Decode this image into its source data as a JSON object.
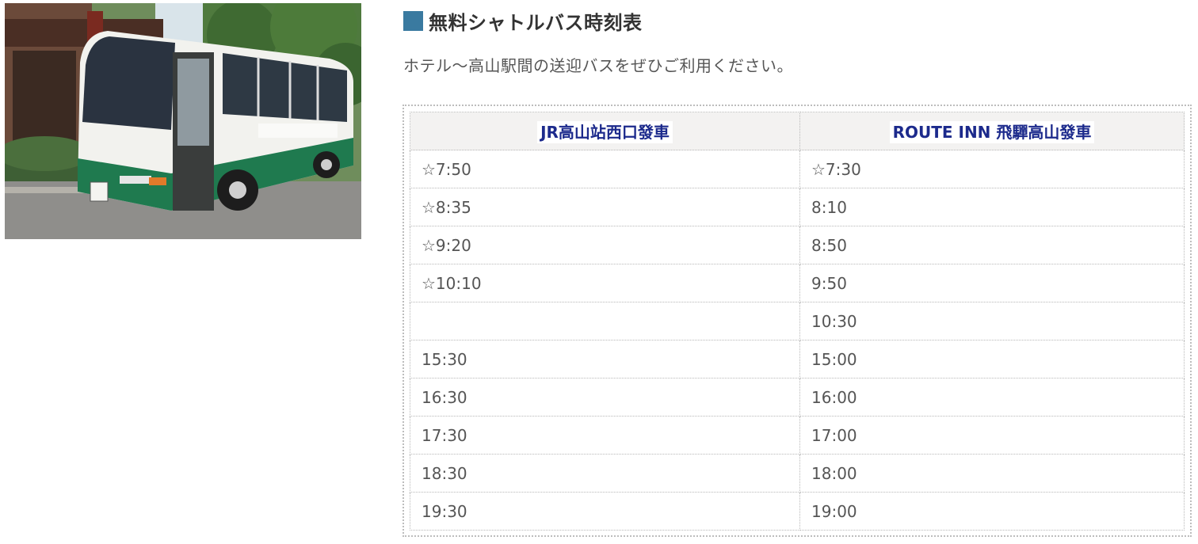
{
  "photo": {
    "alt": "bus-photo"
  },
  "heading": {
    "title": "無料シャトルバス時刻表",
    "accent_color": "#3a7aa0"
  },
  "intro": "ホテル～高山駅間の送迎バスをぜひご利用ください。",
  "timetable": {
    "headers": [
      "JR高山站西口發車",
      "ROUTE INN 飛驒高山發車"
    ],
    "rows": [
      [
        "☆7:50",
        "☆7:30"
      ],
      [
        "☆8:35",
        "8:10"
      ],
      [
        "☆9:20",
        "8:50"
      ],
      [
        "☆10:10",
        "9:50"
      ],
      [
        "",
        "10:30"
      ],
      [
        "15:30",
        "15:00"
      ],
      [
        "16:30",
        "16:00"
      ],
      [
        "17:30",
        "17:00"
      ],
      [
        "18:30",
        "18:00"
      ],
      [
        "19:30",
        "19:00"
      ]
    ],
    "header_text_color": "#1c2a8c"
  }
}
